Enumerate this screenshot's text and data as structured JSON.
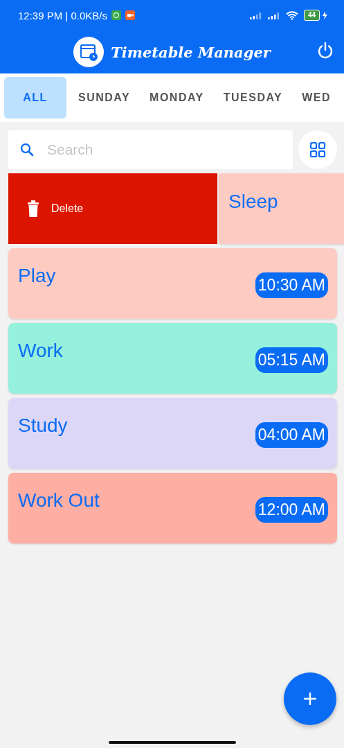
{
  "status_bar": {
    "time": "12:39 PM | 0.0KB/s",
    "battery": "44"
  },
  "app_bar": {
    "title": "Timetable Manager"
  },
  "tabs": [
    {
      "label": "ALL",
      "selected": true
    },
    {
      "label": "SUNDAY",
      "selected": false
    },
    {
      "label": "MONDAY",
      "selected": false
    },
    {
      "label": "TUESDAY",
      "selected": false
    },
    {
      "label": "WED",
      "selected": false
    }
  ],
  "search": {
    "placeholder": "Search"
  },
  "tasks": [
    {
      "kind": "swiped",
      "title": "Sleep",
      "color": "#fecbc3",
      "action": "Delete"
    },
    {
      "kind": "normal",
      "title": "Play",
      "time": "10:30 AM",
      "color": "#fecbc3"
    },
    {
      "kind": "normal",
      "title": "Work",
      "time": "05:15 AM",
      "color": "#95f0dc"
    },
    {
      "kind": "normal",
      "title": "Study",
      "time": "04:00 AM",
      "color": "#ddd7f7"
    },
    {
      "kind": "normal",
      "title": "Work Out",
      "time": "12:00 AM",
      "color": "#feaea3"
    }
  ]
}
